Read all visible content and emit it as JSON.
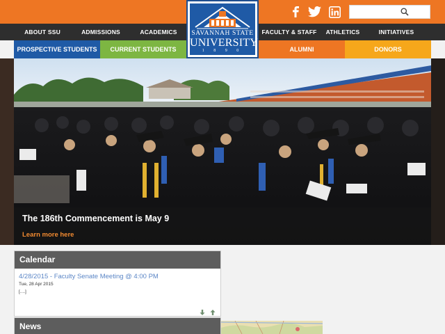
{
  "colors": {
    "orange": "#ee7623",
    "navy": "#1f5aa6",
    "dark_nav": "#2e2e2e",
    "green": "#7db642",
    "gold": "#f6a71b",
    "link_orange": "#f28a30"
  },
  "social": {
    "facebook_icon": "facebook-icon",
    "twitter_icon": "twitter-icon",
    "linkedin_icon": "linkedin-icon"
  },
  "search": {
    "placeholder": "",
    "value": "",
    "icon": "search-icon"
  },
  "nav": {
    "left": [
      "ABOUT SSU",
      "ADMISSIONS",
      "ACADEMICS"
    ],
    "right": [
      "FACULTY & STAFF",
      "ATHLETICS",
      "INITIATIVES"
    ]
  },
  "logo": {
    "line1": "SAVANNAH STATE",
    "line2": "UNIVERSITY",
    "line3": "1 8 9 0"
  },
  "subnav": {
    "prospective": "PROSPECTIVE STUDENTS",
    "current": "CURRENT STUDENTS",
    "alumni": "ALUMNI",
    "donors": "DONORS"
  },
  "hero": {
    "title": "The 186th Commencement is May 9",
    "link": "Learn more here"
  },
  "calendar": {
    "heading": "Calendar",
    "event_title": "4/28/2015 - Faculty Senate Meeting @ 4:00 PM",
    "event_date": "Tue, 28 Apr 2015",
    "event_more": "[....]",
    "down_icon": "arrow-down-icon",
    "up_icon": "arrow-up-icon"
  },
  "news": {
    "heading": "News"
  }
}
